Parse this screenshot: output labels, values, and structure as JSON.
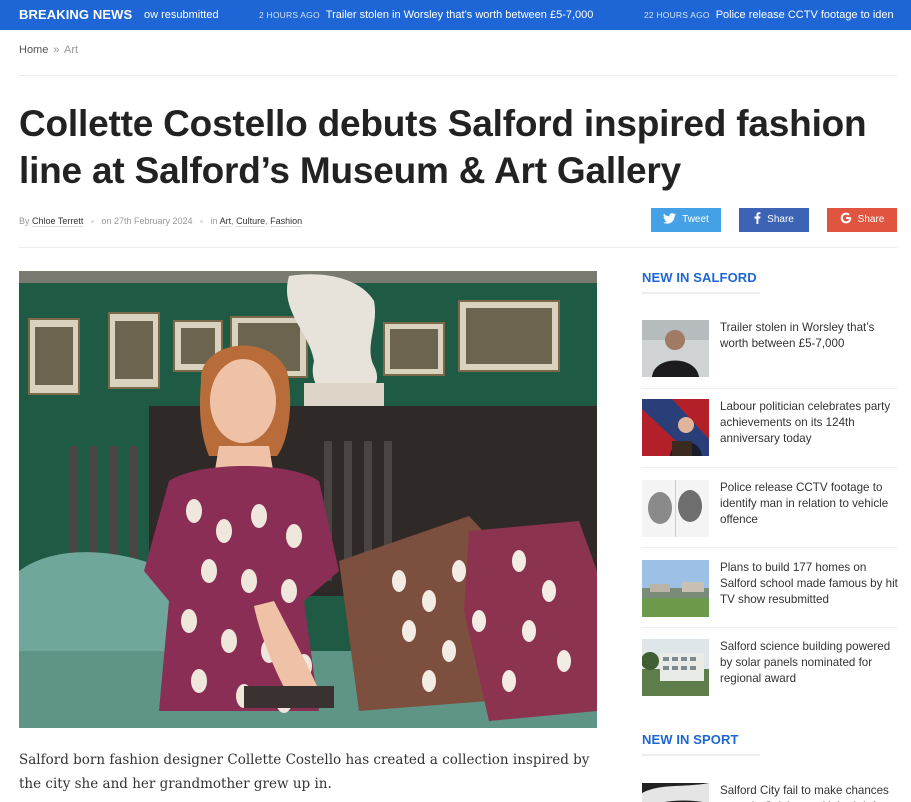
{
  "breaking": {
    "label": "BREAKING NEWS",
    "items": [
      {
        "time": "",
        "text": "ow resubmitted"
      },
      {
        "time": "2 HOURS AGO",
        "text": "Trailer stolen in Worsley that’s worth between £5-7,000"
      },
      {
        "time": "22 HOURS AGO",
        "text": "Police release CCTV footage to iden"
      }
    ]
  },
  "breadcrumb": {
    "home": "Home",
    "separator": "»",
    "current": "Art"
  },
  "article": {
    "title": "Collette Costello debuts Salford inspired fashion line at Salford’s Museum & Art Gallery",
    "by_label": "By",
    "author": "Chloe Terrett",
    "date_prefix": "on",
    "date": "27th February 2024",
    "in_label": "in",
    "categories": [
      "Art",
      "Culture",
      "Fashion"
    ],
    "lead": "Salford born fashion designer Collette Costello has created a collection inspired by the city she and her grandmother grew up in."
  },
  "share": {
    "twitter": "Tweet",
    "facebook": "Share",
    "google": "Share"
  },
  "sidebar": {
    "new_in_salford": {
      "heading": "NEW IN SALFORD",
      "items": [
        {
          "title": "Trailer stolen in Worsley that’s worth between £5-7,000"
        },
        {
          "title": "Labour politician celebrates party achievements on its 124th anniversary today"
        },
        {
          "title": "Police release CCTV footage to identify man in relation to vehicle offence"
        },
        {
          "title": "Plans to build 177 homes on Salford school made famous by hit TV show resubmitted"
        },
        {
          "title": "Salford science building powered by solar panels nominated for regional award"
        }
      ]
    },
    "new_in_sport": {
      "heading": "NEW IN SPORT",
      "items": [
        {
          "title": "Salford City fail to make chances count in Colchester United defeat"
        }
      ]
    }
  },
  "colors": {
    "brand_blue": "#1e66d6",
    "twitter": "#44a1e6",
    "facebook": "#3c63b4",
    "google": "#e0553f"
  }
}
